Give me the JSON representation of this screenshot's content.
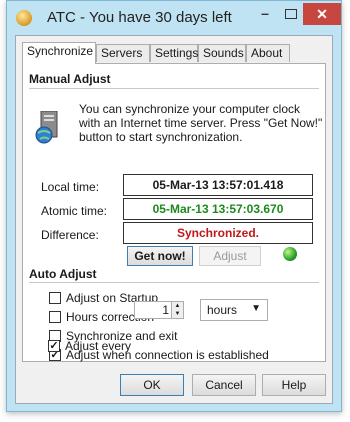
{
  "window": {
    "title": "ATC - You have 30 days left",
    "controls": {
      "minimize": "–",
      "close": "✕"
    }
  },
  "tabs": [
    "Synchronize",
    "Servers",
    "Settings",
    "Sounds",
    "About"
  ],
  "active_tab": "Synchronize",
  "manual_adjust": {
    "heading": "Manual Adjust",
    "description": "You can synchronize your computer clock with an Internet time server. Press \"Get Now!\" button to start synchronization.",
    "local_time_label": "Local time:",
    "local_time_value": "05-Mar-13 13:57:01.418",
    "atomic_time_label": "Atomic time:",
    "atomic_time_value": "05-Mar-13 13:57:03.670",
    "difference_label": "Difference:",
    "difference_value": "Synchronized.",
    "get_now_label": "Get now!",
    "adjust_label": "Adjust"
  },
  "auto_adjust": {
    "heading": "Auto Adjust",
    "options": [
      {
        "label": "Adjust on Startup",
        "checked": false
      },
      {
        "label": "Hours correction",
        "checked": false
      },
      {
        "label": "Synchronize and exit",
        "checked": false
      },
      {
        "label": "Adjust when connection is established",
        "checked": true
      },
      {
        "label": "Adjust every",
        "checked": true
      }
    ],
    "interval_value": "1",
    "interval_unit": "hours"
  },
  "footer": {
    "ok": "OK",
    "cancel": "Cancel",
    "help": "Help"
  },
  "colors": {
    "atomic_text": "#1e8a1e",
    "difference_text": "#c01818",
    "close_button": "#c7463f"
  }
}
